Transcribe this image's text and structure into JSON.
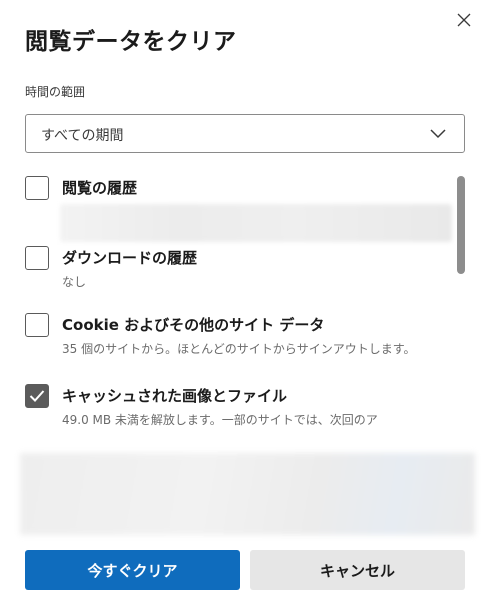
{
  "dialog": {
    "title": "閲覧データをクリア",
    "close_icon": "close-icon"
  },
  "time_range": {
    "label": "時間の範囲",
    "selected": "すべての期間",
    "dropdown_icon": "chevron-down-icon"
  },
  "items": [
    {
      "label": "閲覧の履歴",
      "description": "",
      "checked": false
    },
    {
      "label": "ダウンロードの履歴",
      "description": "なし",
      "checked": false
    },
    {
      "label": "Cookie およびその他のサイト データ",
      "description": "35 個のサイトから。ほとんどのサイトからサインアウトします。",
      "checked": false
    },
    {
      "label": "キャッシュされた画像とファイル",
      "description": "49.0 MB 未満を解放します。一部のサイトでは、次回のア",
      "checked": true
    }
  ],
  "buttons": {
    "clear_now": "今すぐクリア",
    "cancel": "キャンセル"
  },
  "colors": {
    "primary": "#0f6cbd",
    "secondary": "#e6e6e6",
    "checked": "#5b5b5b"
  }
}
